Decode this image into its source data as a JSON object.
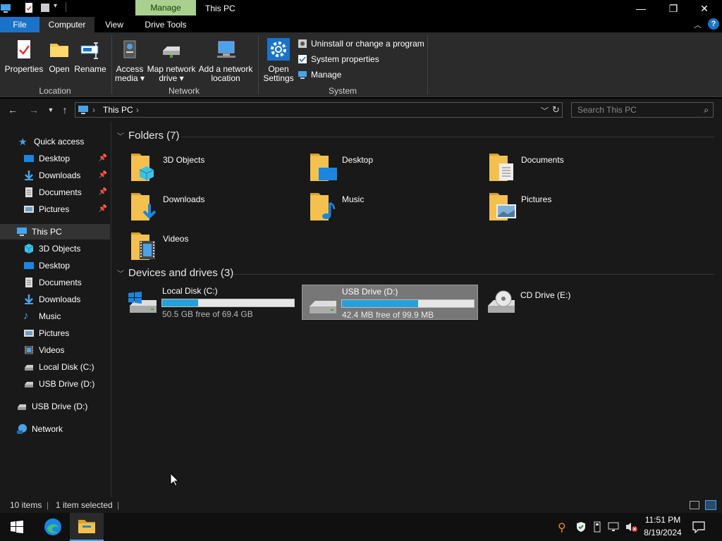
{
  "window": {
    "title": "This PC",
    "contextual_tab": "Manage",
    "controls": {
      "minimize": "—",
      "maximize": "❐",
      "close": "✕"
    }
  },
  "ribbon_tabs": {
    "file": "File",
    "computer": "Computer",
    "view": "View",
    "drive_tools": "Drive Tools"
  },
  "ribbon": {
    "location": {
      "group_label": "Location",
      "properties": "Properties",
      "open": "Open",
      "rename": "Rename"
    },
    "network": {
      "group_label": "Network",
      "access_media_1": "Access",
      "access_media_2": "media ▾",
      "map_drive_1": "Map network",
      "map_drive_2": "drive ▾",
      "add_location_1": "Add a network",
      "add_location_2": "location"
    },
    "system": {
      "group_label": "System",
      "open_settings_1": "Open",
      "open_settings_2": "Settings",
      "uninstall": "Uninstall or change a program",
      "system_properties": "System properties",
      "manage": "Manage"
    }
  },
  "address": {
    "path": "This PC",
    "search_placeholder": "Search This PC"
  },
  "nav": {
    "quick_access": "Quick access",
    "quick_items": [
      "Desktop",
      "Downloads",
      "Documents",
      "Pictures"
    ],
    "this_pc": "This PC",
    "pc_items": [
      "3D Objects",
      "Desktop",
      "Documents",
      "Downloads",
      "Music",
      "Pictures",
      "Videos",
      "Local Disk (C:)",
      "USB Drive (D:)"
    ],
    "usb_root": "USB Drive (D:)",
    "network": "Network"
  },
  "folders": {
    "header": "Folders (7)",
    "items": [
      "3D Objects",
      "Desktop",
      "Documents",
      "Downloads",
      "Music",
      "Pictures",
      "Videos"
    ]
  },
  "devices": {
    "header": "Devices and drives (3)",
    "items": [
      {
        "name": "Local Disk (C:)",
        "free_text": "50.5 GB free of 69.4 GB",
        "used_fraction": 0.272
      },
      {
        "name": "USB Drive (D:)",
        "free_text": "42.4 MB free of 99.9 MB",
        "used_fraction": 0.576
      },
      {
        "name": "CD Drive (E:)"
      }
    ]
  },
  "status": {
    "count": "10 items",
    "selected": "1 item selected"
  },
  "taskbar": {
    "time": "11:51 PM",
    "date": "8/19/2024"
  },
  "colors": {
    "accent": "#1a73c8",
    "bar_fill": "#26a0da",
    "folder": "#f4c150"
  }
}
